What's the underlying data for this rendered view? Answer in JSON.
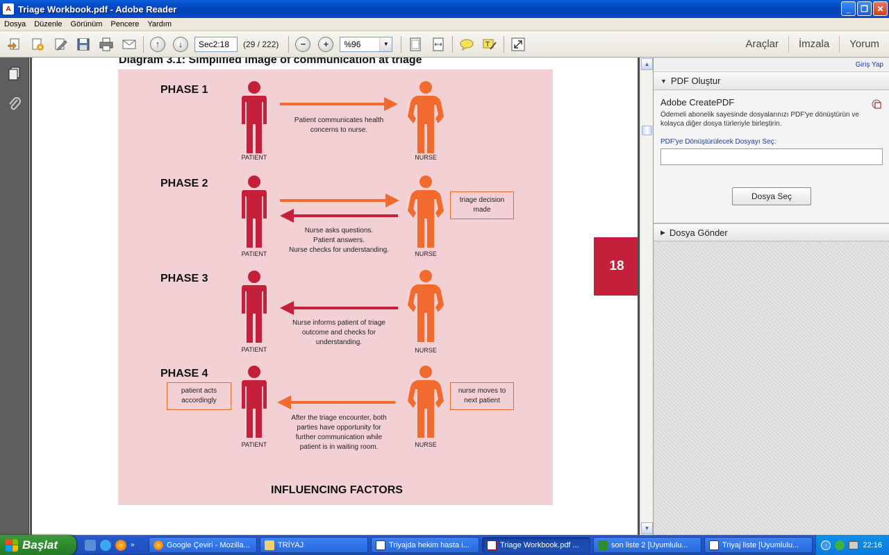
{
  "window": {
    "title": "Triage Workbook.pdf - Adobe Reader",
    "app_icon_glyph": "A"
  },
  "menu": [
    "Dosya",
    "Düzenle",
    "Görünüm",
    "Pencere",
    "Yardım"
  ],
  "toolbar": {
    "page_value": "Sec2:18",
    "page_count": "(29 / 222)",
    "zoom_value": "%96",
    "right_tools": [
      "Araçlar",
      "İmzala",
      "Yorum"
    ]
  },
  "document": {
    "diagram_title": "Diagram 3.1: Simplified image of communication at triage",
    "page_tab": "18",
    "patient_label": "PATIENT",
    "nurse_label": "NURSE",
    "phases": [
      {
        "label": "PHASE 1",
        "desc": [
          "Patient communicates health",
          "concerns to nurse."
        ]
      },
      {
        "label": "PHASE 2",
        "desc": [
          "Nurse asks questions.",
          "Patient answers.",
          "Nurse checks for understanding."
        ],
        "nurse_box": [
          "triage decision",
          "made"
        ]
      },
      {
        "label": "PHASE 3",
        "desc": [
          "Nurse informs patient of triage",
          "outcome and checks for",
          "understanding."
        ]
      },
      {
        "label": "PHASE 4",
        "desc": [
          "After the triage encounter, both",
          "parties have opportunity for",
          "further communication while",
          "patient is in waiting room."
        ],
        "patient_box": [
          "patient acts",
          "accordingly"
        ],
        "nurse_box": [
          "nurse moves to",
          "next patient"
        ]
      }
    ],
    "influencing_factors": "INFLUENCING FACTORS",
    "colors": {
      "patient": "#c41f3b",
      "nurse": "#f26a2e",
      "pink_bg": "#f2d0d4"
    }
  },
  "right_panel": {
    "login": "Giriş Yap",
    "pdf_create_header": "PDF Oluştur",
    "createpdf_title": "Adobe CreatePDF",
    "createpdf_desc": "Ödemeli abonelik sayesinde dosyalarınızı PDF'ye dönüştürün ve kolayca diğer dosya türleriyle birleştirin.",
    "file_label": "PDF'ye Dönüştürülecek Dosyayı Seç:",
    "file_input": "",
    "select_button": "Dosya Seç",
    "send_header": "Dosya Gönder"
  },
  "taskbar": {
    "start": "Başlat",
    "tasks": [
      {
        "label": "Google Çeviri - Mozilla...",
        "icon": "firefox-icon",
        "active": false
      },
      {
        "label": "TRİYAJ",
        "icon": "folder-icon",
        "active": false
      },
      {
        "label": "Triyajda hekim hasta i...",
        "icon": "word-icon",
        "active": false
      },
      {
        "label": "Triage Workbook.pdf ...",
        "icon": "pdf-icon",
        "active": true
      },
      {
        "label": "son liste 2  [Uyumlulu...",
        "icon": "excel-icon",
        "active": false
      },
      {
        "label": "Triyaj liste  [Uyumlulu...",
        "icon": "word-icon",
        "active": false
      }
    ],
    "clock": "22:16"
  }
}
